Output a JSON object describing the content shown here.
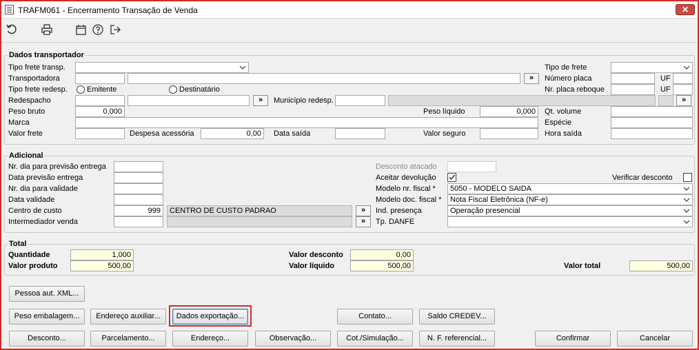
{
  "window": {
    "title": "TRAFM061 - Encerramento Transação de Venda",
    "close_glyph": "✕"
  },
  "toolbar": {
    "icons": [
      "undo-icon",
      "print-icon",
      "calendar-icon",
      "help-icon",
      "exit-icon"
    ]
  },
  "transportador": {
    "legend": "Dados transportador",
    "tipo_frete_transp_label": "Tipo frete transp.",
    "tipo_frete_transp_value": "",
    "transportadora_label": "Transportadora",
    "transportadora_code": "",
    "transportadora_name": "",
    "tipo_frete_redesp_label": "Tipo frete redesp.",
    "emitente_label": "Emitente",
    "destinatario_label": "Destinatário",
    "redespacho_label": "Redespacho",
    "municipio_redesp_label": "Município redesp.",
    "peso_bruto_label": "Peso bruto",
    "peso_bruto_value": "0,000",
    "peso_liquido_label": "Peso líquido",
    "peso_liquido_value": "0,000",
    "marca_label": "Marca",
    "valor_frete_label": "Valor frete",
    "despesa_acessoria_label": "Despesa acessória",
    "despesa_acessoria_value": "0,00",
    "data_saida_label": "Data saída",
    "valor_seguro_label": "Valor seguro",
    "tipo_frete_label": "Tipo de frete",
    "numero_placa_label": "Número placa",
    "uf_label": "UF",
    "nr_placa_reboque_label": "Nr. placa reboque",
    "uf2_label": "UF",
    "qt_volume_label": "Qt. volume",
    "especie_label": "Espécie",
    "hora_saida_label": "Hora saída",
    "lookup_glyph": "»"
  },
  "adicional": {
    "legend": "Adicional",
    "nr_dia_prev_label": "Nr. dia para previsão entrega",
    "data_prev_label": "Data previsão entrega",
    "nr_dia_valid_label": "Nr. dia para validade",
    "data_valid_label": "Data validade",
    "centro_custo_label": "Centro de custo",
    "centro_custo_code": "999",
    "centro_custo_name": "CENTRO DE CUSTO PADRAO",
    "intermediador_label": "Intermediador venda",
    "desconto_atacado_label": "Desconto atacado",
    "aceitar_devolucao_label": "Aceitar devolução",
    "aceitar_devolucao_checked": true,
    "verificar_desconto_label": "Verificar desconto",
    "verificar_desconto_checked": false,
    "modelo_nr_fiscal_label": "Modelo nr. fiscal *",
    "modelo_nr_fiscal_value": "5050 - MODELO SAIDA",
    "modelo_doc_fiscal_label": "Modelo doc. fiscal *",
    "modelo_doc_fiscal_value": "Nota Fiscal Eletrônica (NF-e)",
    "ind_presenca_label": "Ind. presença",
    "ind_presenca_value": "Operação presencial",
    "tp_danfe_label": "Tp. DANFE",
    "tp_danfe_value": ""
  },
  "total": {
    "legend": "Total",
    "quantidade_label": "Quantidade",
    "quantidade_value": "1,000",
    "valor_produto_label": "Valor produto",
    "valor_produto_value": "500,00",
    "valor_desconto_label": "Valor desconto",
    "valor_desconto_value": "0,00",
    "valor_liquido_label": "Valor líquido",
    "valor_liquido_value": "500,00",
    "valor_total_label": "Valor total",
    "valor_total_value": "500,00"
  },
  "buttons": {
    "pessoa_aut_xml": "Pessoa aut. XML...",
    "peso_embalagem": "Peso embalagem...",
    "endereco_auxiliar": "Endereço auxiliar...",
    "dados_exportacao": "Dados exportação...",
    "contato": "Contato...",
    "saldo_credev": "Saldo CREDEV...",
    "desconto": "Desconto...",
    "parcelamento": "Parcelamento...",
    "endereco": "Endereço...",
    "observacao": "Observação...",
    "cot_simulacao": "Cot./Simulação...",
    "nf_referencial": "N. F. referencial...",
    "confirmar": "Confirmar",
    "cancelar": "Cancelar"
  },
  "colors": {
    "highlight": "#d72a2a",
    "readonly": "#dcdcdc",
    "totals_bg": "#ffffe1"
  }
}
